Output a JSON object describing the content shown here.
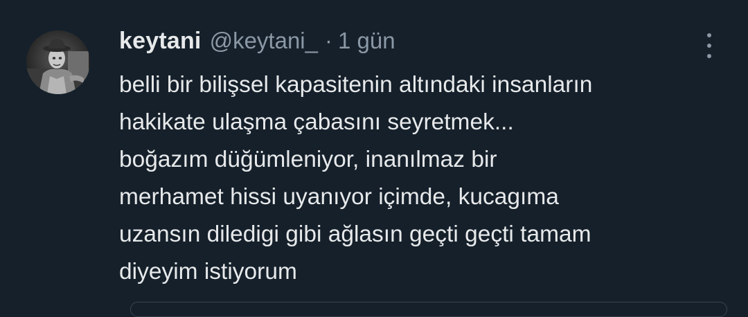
{
  "tweet": {
    "author": {
      "display_name": "keytani",
      "handle": "@keytani_"
    },
    "separator": "·",
    "time": "1 gün",
    "more_icon": "more-vertical-icon",
    "lines": [
      "belli bir bilişsel kapasitenin altındaki insanların",
      "hakikate ulaşma çabasını seyretmek...",
      "boğazım düğümleniyor, inanılmaz bir",
      "merhamet hissi uyanıyor içimde, kucagıma",
      "uzansın diledigi gibi ağlasın geçti geçti tamam",
      "diyeyim istiyorum"
    ]
  },
  "colors": {
    "background": "#15202b",
    "primary_text": "#e7e9ea",
    "secondary_text": "#8b98a5",
    "border": "#38444d"
  }
}
